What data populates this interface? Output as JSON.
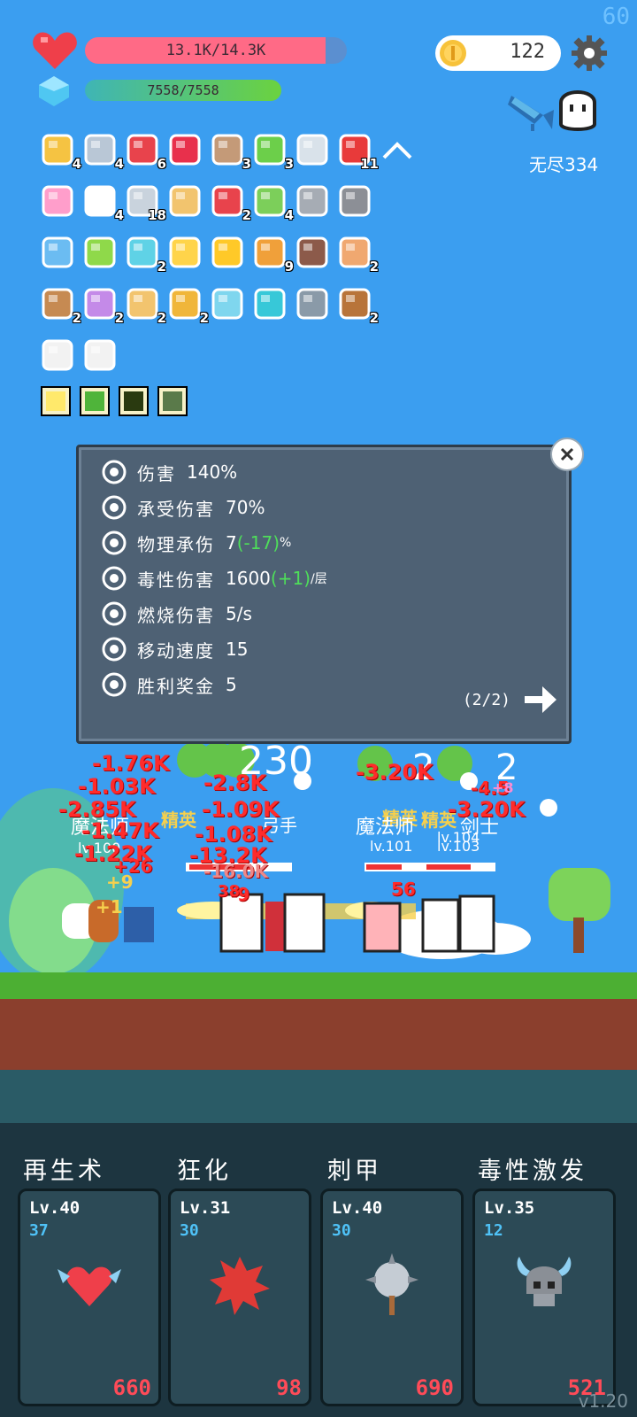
{
  "fps": "60",
  "hp": {
    "text": "13.1K/14.3K",
    "fraction": 0.92
  },
  "mana": {
    "text": "7558/7558",
    "fraction": 1.0
  },
  "coins": "122",
  "mode_label": "无尽334",
  "inventory": [
    {
      "icon": "beer-icon",
      "count": "4"
    },
    {
      "icon": "dagger-icon",
      "count": "4"
    },
    {
      "icon": "watermelon-icon",
      "count": "6"
    },
    {
      "icon": "ruby-icon",
      "count": ""
    },
    {
      "icon": "shield-round-icon",
      "count": "3"
    },
    {
      "icon": "book-icon",
      "count": "3"
    },
    {
      "icon": "sword-icon",
      "count": ""
    },
    {
      "icon": "apple-icon",
      "count": "11"
    },
    {
      "icon": "ice-cream-icon",
      "count": ""
    },
    {
      "icon": "flower-icon",
      "count": "4"
    },
    {
      "icon": "greatsword-icon",
      "count": "18"
    },
    {
      "icon": "scroll-icon",
      "count": ""
    },
    {
      "icon": "thermometer-icon",
      "count": "2"
    },
    {
      "icon": "potion-icon",
      "count": "4"
    },
    {
      "icon": "armor-icon",
      "count": ""
    },
    {
      "icon": "helmet-icon",
      "count": ""
    },
    {
      "icon": "card-icon",
      "count": ""
    },
    {
      "icon": "lime-icon",
      "count": ""
    },
    {
      "icon": "feather-icon",
      "count": "2"
    },
    {
      "icon": "sun-icon",
      "count": ""
    },
    {
      "icon": "sunflower-icon",
      "count": ""
    },
    {
      "icon": "tome-icon",
      "count": "9"
    },
    {
      "icon": "door-icon",
      "count": ""
    },
    {
      "icon": "briefcase-icon",
      "count": "2"
    },
    {
      "icon": "crossbow-icon",
      "count": "2"
    },
    {
      "icon": "tulip-icon",
      "count": "2"
    },
    {
      "icon": "parchment-icon",
      "count": "2"
    },
    {
      "icon": "pineapple-icon",
      "count": "2"
    },
    {
      "icon": "molecule-icon",
      "count": ""
    },
    {
      "icon": "target-icon",
      "count": ""
    },
    {
      "icon": "compass-icon",
      "count": ""
    },
    {
      "icon": "flag-cake-icon",
      "count": "2"
    },
    {
      "icon": "mail-icon",
      "count": ""
    },
    {
      "icon": "playing-cards-icon",
      "count": ""
    }
  ],
  "buffs": [
    "glow-buff-icon",
    "sprout-buff-icon",
    "creeper-buff-icon",
    "camo-buff-icon"
  ],
  "stats_panel": {
    "page": "(2/2)",
    "rows": [
      {
        "icon": "crossed-axes-icon",
        "label": "伤害",
        "value": "140%",
        "delta": "",
        "suffix": ""
      },
      {
        "icon": "target-rings-icon",
        "label": "承受伤害",
        "value": "70%",
        "delta": "",
        "suffix": ""
      },
      {
        "icon": "shield-icon",
        "label": "物理承伤",
        "value": "7",
        "delta": "(-17)",
        "suffix": "%"
      },
      {
        "icon": "horned-skull-icon",
        "label": "毒性伤害",
        "value": "1600",
        "delta": "(+1)",
        "suffix": "/层"
      },
      {
        "icon": "flame-icon",
        "label": "燃烧伤害",
        "value": "5/s",
        "delta": "",
        "suffix": ""
      },
      {
        "icon": "boot-icon",
        "label": "移动速度",
        "value": "15",
        "delta": "",
        "suffix": ""
      },
      {
        "icon": "money-bag-icon",
        "label": "胜利奖金",
        "value": "5",
        "delta": "",
        "suffix": ""
      }
    ]
  },
  "battle": {
    "enemy_labels": [
      "魔法师",
      "精英",
      "弓手",
      "精英",
      "魔法师",
      "精英",
      "剑士"
    ],
    "enemy_levels": [
      "lv.100",
      "lv.101",
      "lv.103",
      "lv.104"
    ],
    "counters": [
      "230",
      "2",
      "2"
    ],
    "damage_numbers": [
      "-1.76K",
      "-1.03K",
      "-2.85K",
      "-1.47K",
      "-1.22K",
      "-2.8K",
      "-1.09K",
      "-1.08K",
      "-13.2K",
      "-16.0K",
      "-3.20K",
      "-3.20K",
      "-4.5",
      "-9"
    ],
    "heal_numbers": [
      "+9",
      "+1",
      "+26",
      "+8",
      "56",
      "38"
    ]
  },
  "skills": [
    {
      "name": "再生术",
      "level": "Lv.40",
      "sub": "37",
      "cost": "660",
      "icon": "winged-heart-icon"
    },
    {
      "name": "狂化",
      "level": "Lv.31",
      "sub": "30",
      "cost": "98",
      "icon": "rage-splat-icon"
    },
    {
      "name": "刺甲",
      "level": "Lv.40",
      "sub": "30",
      "cost": "690",
      "icon": "spiked-mace-icon"
    },
    {
      "name": "毒性激发",
      "level": "Lv.35",
      "sub": "12",
      "cost": "521",
      "icon": "viking-helmet-icon"
    }
  ],
  "version": "v1.20"
}
